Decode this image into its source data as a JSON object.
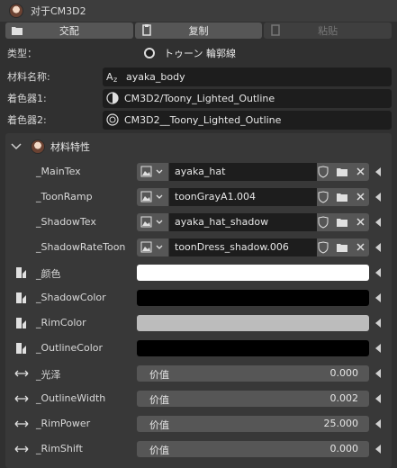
{
  "header": {
    "title": "对于CM3D2"
  },
  "toolbar": {
    "left_label": "交配",
    "copy_label": "复制",
    "paste_label": "粘贴"
  },
  "type_row": {
    "label": "类型：",
    "value": "トゥーン 輪郭線"
  },
  "material_name": {
    "label": "材料名称:",
    "value": "ayaka_body"
  },
  "shader1": {
    "label": "着色器1:",
    "value": "CM3D2/Toony_Lighted_Outline"
  },
  "shader2": {
    "label": "着色器2:",
    "value": "CM3D2__Toony_Lighted_Outline"
  },
  "section": {
    "title": "材料特性"
  },
  "textures": [
    {
      "name": "_MainTex",
      "value": "ayaka_hat"
    },
    {
      "name": "_ToonRamp",
      "value": "toonGrayA1.004"
    },
    {
      "name": "_ShadowTex",
      "value": "ayaka_hat_shadow"
    },
    {
      "name": "_ShadowRateToon",
      "value": "toonDress_shadow.006"
    }
  ],
  "colors": [
    {
      "name": "_颜色",
      "hex": "#ffffff"
    },
    {
      "name": "_ShadowColor",
      "hex": "#000000"
    },
    {
      "name": "_RimColor",
      "hex": "#bcbcbc"
    },
    {
      "name": "_OutlineColor",
      "hex": "#000000"
    }
  ],
  "floats": [
    {
      "name": "_光泽",
      "label": "价值",
      "value": "0.000"
    },
    {
      "name": "_OutlineWidth",
      "label": "价值",
      "value": "0.002"
    },
    {
      "name": "_RimPower",
      "label": "价值",
      "value": "25.000"
    },
    {
      "name": "_RimShift",
      "label": "价值",
      "value": "0.000"
    }
  ]
}
